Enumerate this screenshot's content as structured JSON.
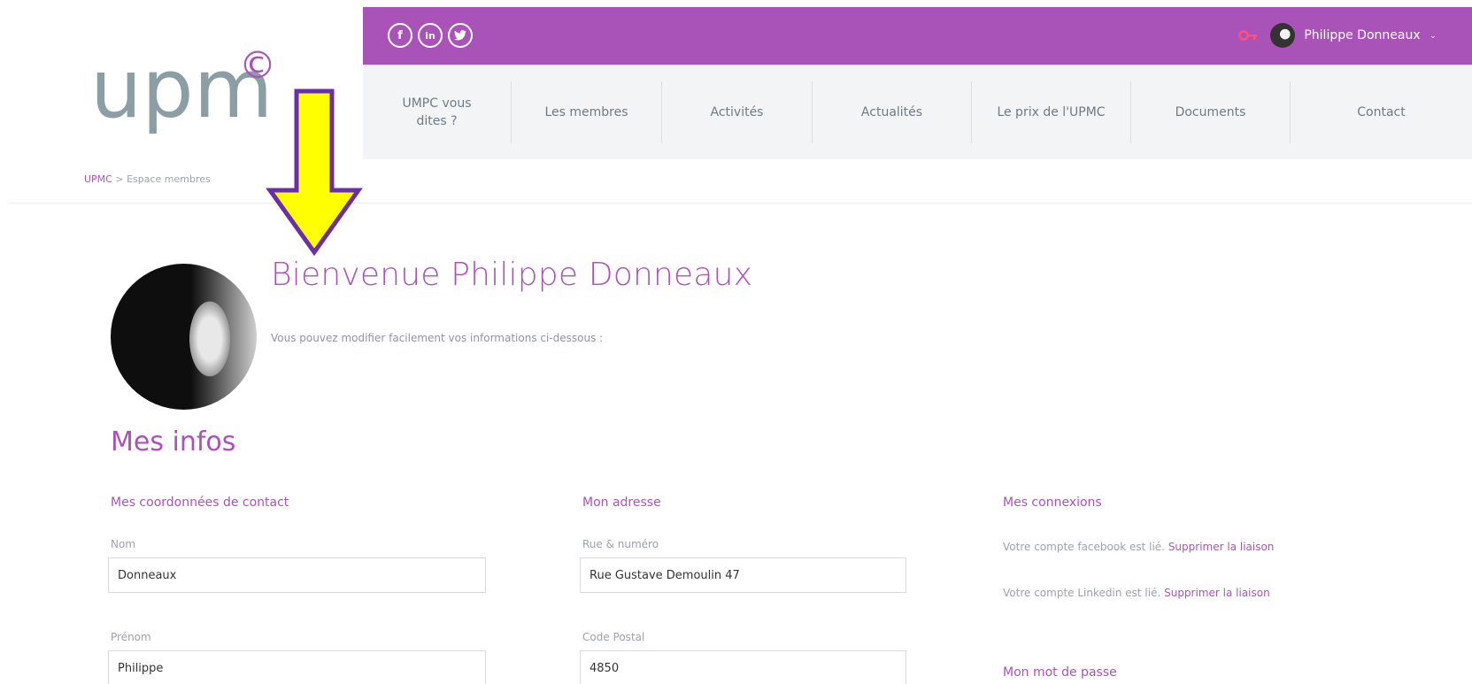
{
  "logo": {
    "text": "upm",
    "mark": "©"
  },
  "topbar": {
    "social": [
      {
        "icon": "facebook-icon",
        "glyph": "f"
      },
      {
        "icon": "linkedin-icon",
        "glyph": "in"
      },
      {
        "icon": "twitter-icon",
        "glyph": "t"
      }
    ],
    "user_name": "Philippe Donneaux",
    "accent": "#a953b8"
  },
  "nav": {
    "items": [
      {
        "label": "UMPC vous\ndites ?"
      },
      {
        "label": "Les membres"
      },
      {
        "label": "Activités"
      },
      {
        "label": "Actualités"
      },
      {
        "label": "Le prix de l'UPMC"
      },
      {
        "label": "Documents"
      },
      {
        "label": "Contact"
      }
    ]
  },
  "breadcrumb": {
    "root": "UPMC",
    "separator": ">",
    "current": "Espace membres"
  },
  "profile": {
    "welcome": "Bienvenue Philippe Donneaux",
    "subtitle": "Vous pouvez modifier facilement vos informations ci-dessous :"
  },
  "infos": {
    "title": "Mes infos",
    "contact": {
      "title": "Mes coordonnées de contact",
      "nom_label": "Nom",
      "nom_value": "Donneaux",
      "prenom_label": "Prénom",
      "prenom_value": "Philippe"
    },
    "adresse": {
      "title": "Mon adresse",
      "rue_label": "Rue & numéro",
      "rue_value": "Rue Gustave Demoulin 47",
      "cp_label": "Code Postal",
      "cp_value": "4850"
    },
    "connexions": {
      "title": "Mes connexions",
      "facebook_text": "Votre compte facebook est lié.",
      "facebook_link": "Supprimer la liaison",
      "linkedin_text": "Votre compte Linkedin est lié.",
      "linkedin_link": "Supprimer la liaison",
      "password_title": "Mon mot de passe"
    }
  }
}
